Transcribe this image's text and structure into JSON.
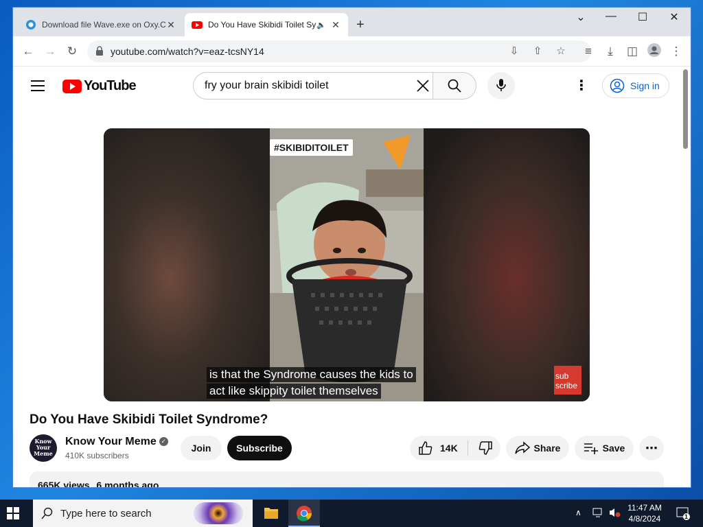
{
  "browser": {
    "tabs": [
      {
        "title": "Download file Wave.exe on Oxy.C"
      },
      {
        "title": "Do You Have Skibidi Toilet Sy"
      }
    ],
    "url": "youtube.com/watch?v=eaz-tcsNY14"
  },
  "youtube": {
    "logo_text": "YouTube",
    "search_query": "fry your brain skibidi toilet",
    "signin_label": "Sign in",
    "video": {
      "overlay_tag": "#SKIBIDITOILET",
      "caption_line1": "is that the Syndrome causes the kids to",
      "caption_line2": "act like skippity toilet themselves",
      "watermark_line1": "sub",
      "watermark_line2": "scribe",
      "title": "Do You Have Skibidi Toilet Syndrome?"
    },
    "channel": {
      "avatar_text_1": "Know",
      "avatar_text_2": "Your",
      "avatar_text_3": "Meme",
      "name": "Know Your Meme",
      "subscribers": "410K subscribers"
    },
    "actions": {
      "join": "Join",
      "subscribe": "Subscribe",
      "likes": "14K",
      "share": "Share",
      "save": "Save"
    },
    "description": {
      "views": "665K views",
      "age": "6 months ago"
    }
  },
  "taskbar": {
    "search_placeholder": "Type here to search",
    "time": "11:47 AM",
    "date": "4/8/2024",
    "notification_count": "1"
  },
  "colors": {
    "youtube_red": "#ff0000",
    "link_blue": "#065fd4",
    "desktop_blue": "#1a6fc9"
  }
}
